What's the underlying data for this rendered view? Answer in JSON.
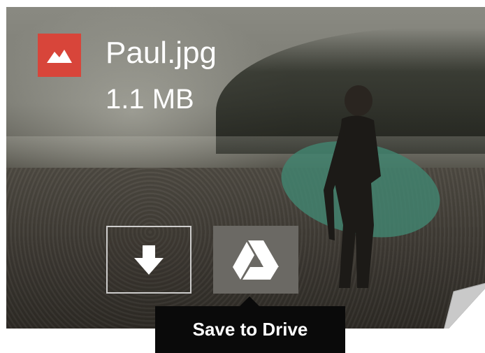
{
  "file": {
    "name": "Paul.jpg",
    "size": "1.1 MB",
    "icon": "image-file-icon",
    "icon_color": "#d8453a"
  },
  "actions": {
    "download": {
      "icon": "download-arrow-icon"
    },
    "save_to_drive": {
      "icon": "google-drive-icon",
      "tooltip": "Save to Drive"
    }
  },
  "preview": {
    "subject": "surfer-photo"
  }
}
